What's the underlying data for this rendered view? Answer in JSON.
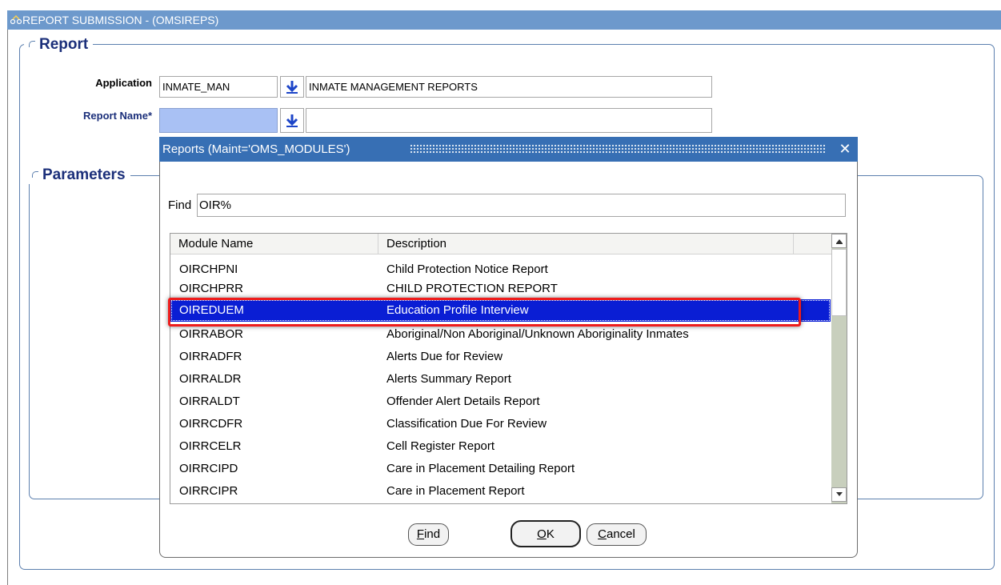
{
  "window": {
    "title": "REPORT SUBMISSION - (OMSIREPS)"
  },
  "report_section": {
    "title": "Report",
    "application_label": "Application",
    "application_code": "INMATE_MAN",
    "application_desc": "INMATE MANAGEMENT REPORTS",
    "report_name_label": "Report Name*",
    "report_name_value": "",
    "report_name_desc": ""
  },
  "parameters_section": {
    "title": "Parameters"
  },
  "dialog": {
    "title": "Reports (Maint='OMS_MODULES')",
    "close_glyph": "✕",
    "find_label": "Find",
    "find_value": "OIR%",
    "columns": [
      "Module Name",
      "Description"
    ],
    "rows": [
      {
        "module": "OIRCHPNI",
        "description": "Child Protection Notice Report"
      },
      {
        "module": "OIRCHPRR",
        "description": "CHILD PROTECTION REPORT"
      },
      {
        "module": "OIREDUEM",
        "description": "Education Profile Interview"
      },
      {
        "module": "OIRRABOR",
        "description": "Aboriginal/Non Aboriginal/Unknown Aboriginality Inmates"
      },
      {
        "module": "OIRRADFR",
        "description": "Alerts Due for Review"
      },
      {
        "module": "OIRRALDR",
        "description": "Alerts Summary Report"
      },
      {
        "module": "OIRRALDT",
        "description": "Offender Alert Details Report"
      },
      {
        "module": "OIRRCDFR",
        "description": "Classification Due For Review"
      },
      {
        "module": "OIRRCELR",
        "description": "Cell Register Report"
      },
      {
        "module": "OIRRCIPD",
        "description": "Care in Placement Detailing Report"
      },
      {
        "module": "OIRRCIPR",
        "description": "Care in Placement Report"
      }
    ],
    "selected_index": 2,
    "buttons": {
      "find": {
        "mnemonic": "F",
        "rest": "ind"
      },
      "ok": {
        "mnemonic": "O",
        "rest": "K"
      },
      "cancel": {
        "mnemonic": "C",
        "rest": "ancel"
      }
    }
  },
  "colors": {
    "title_bar": "#6d99cc",
    "dialog_title": "#376fb4",
    "selection": "#0a1ed4",
    "highlight_box": "#ee1c1c",
    "label_blue": "#1b2f7a"
  }
}
